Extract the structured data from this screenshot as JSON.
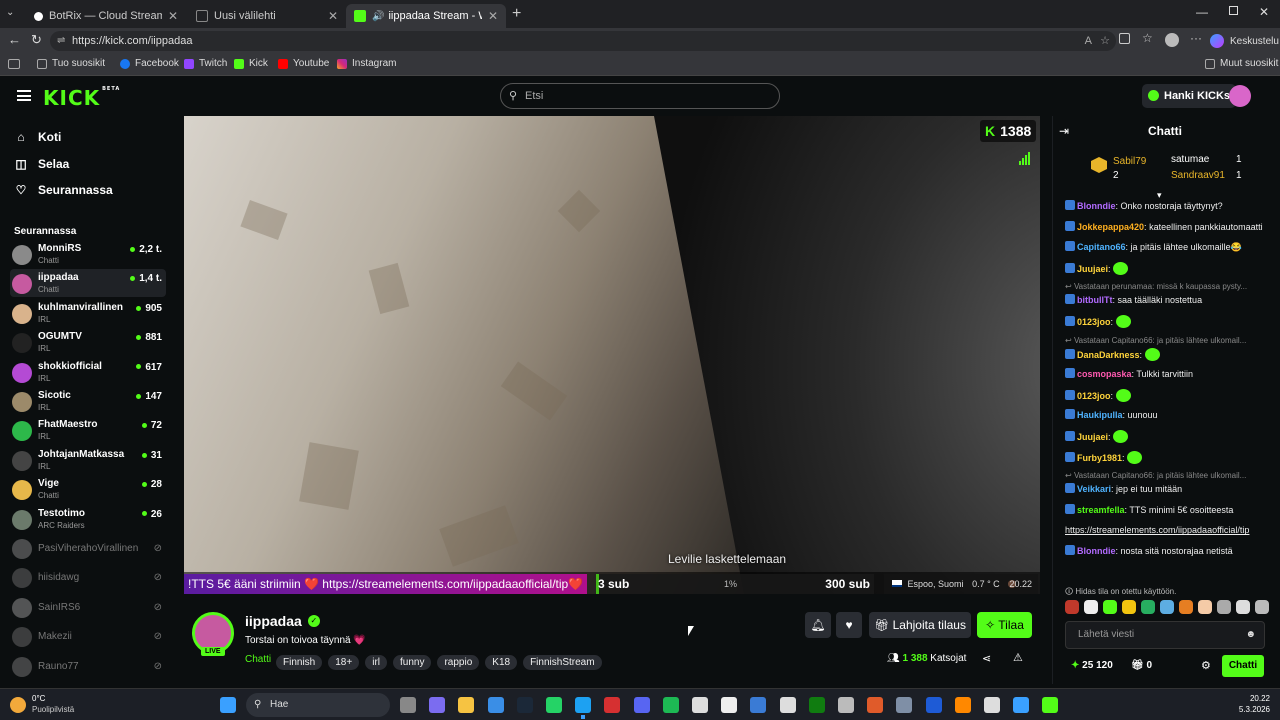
{
  "browser": {
    "tabs": [
      {
        "title": "BotRix — Cloud Streaming Bot for"
      },
      {
        "title": "Uusi välilehti"
      },
      {
        "title": "iippadaa Stream - Watch Live"
      }
    ],
    "url": "https://kick.com/iippadaa",
    "profile_label": "Keskustelu",
    "bookmarks": [
      "Tuo suosikit",
      "Facebook",
      "Twitch",
      "Kick",
      "Youtube",
      "Instagram"
    ],
    "other_bookmarks": "Muut suosikit"
  },
  "header": {
    "logo": "KICK",
    "logo_sup": "BETA",
    "search_placeholder": "Etsi",
    "get_kicks": "Hanki KICKs"
  },
  "nav": [
    {
      "label": "Koti",
      "icon": "home-icon"
    },
    {
      "label": "Selaa",
      "icon": "browse-icon"
    },
    {
      "label": "Seurannassa",
      "icon": "heart-icon"
    }
  ],
  "following_title": "Seurannassa",
  "following": [
    {
      "name": "MonniRS",
      "category": "Chatti",
      "viewers": "2,2 t.",
      "color": "#8a8a8a",
      "live": true
    },
    {
      "name": "iippadaa",
      "category": "Chatti",
      "viewers": "1,4 t.",
      "color": "#c65aa0",
      "live": true
    },
    {
      "name": "kuhlmanvirallinen",
      "category": "IRL",
      "viewers": "905",
      "color": "#d9b38c",
      "live": true
    },
    {
      "name": "OGUMTV",
      "category": "IRL",
      "viewers": "881",
      "color": "#222",
      "live": true
    },
    {
      "name": "shokkiofficial",
      "category": "IRL",
      "viewers": "617",
      "color": "#b44ad4",
      "live": true
    },
    {
      "name": "Sicotic",
      "category": "IRL",
      "viewers": "147",
      "color": "#9c8a6a",
      "live": true
    },
    {
      "name": "FhatMaestro",
      "category": "IRL",
      "viewers": "72",
      "color": "#2db84a",
      "live": true
    },
    {
      "name": "JohtajanMatkassa",
      "category": "IRL",
      "viewers": "31",
      "color": "#444",
      "live": true
    },
    {
      "name": "Vige",
      "category": "Chatti",
      "viewers": "28",
      "color": "#e7b84a",
      "live": true
    },
    {
      "name": "Testotimo",
      "category": "ARC Raiders",
      "viewers": "26",
      "color": "#6b7a6b",
      "live": true
    },
    {
      "name": "PasiViherahoVirallinen",
      "category": "",
      "viewers": "",
      "color": "#999",
      "live": false
    },
    {
      "name": "hiisidawg",
      "category": "",
      "viewers": "",
      "color": "#777",
      "live": false
    },
    {
      "name": "SainIRS6",
      "category": "",
      "viewers": "",
      "color": "#aaa",
      "live": false
    },
    {
      "name": "Makezii",
      "category": "",
      "viewers": "",
      "color": "#777",
      "live": false
    },
    {
      "name": "Rauno77",
      "category": "",
      "viewers": "",
      "color": "#888",
      "live": false
    }
  ],
  "video": {
    "viewer_badge": "1388",
    "caption": "Levilie laskettelemaan",
    "tip_text": "!TTS 5€ ääni striimiin ❤️ https://streamelements.com/iippadaaofficial/tip❤️",
    "sub_goal": {
      "current": "3 sub",
      "percent": "1%",
      "target": "300 sub",
      "progress": 0.01
    },
    "location": "Espoo, Suomi",
    "temperature": "0.7 ° C",
    "time": "20.22"
  },
  "stream": {
    "channel": "iippadaa",
    "live_label": "LIVE",
    "title": "Torstai on toivoa täynnä 💗",
    "tags": [
      "Chatti",
      "Finnish",
      "18+",
      "irl",
      "funny",
      "rappio",
      "K18",
      "FinnishStream"
    ],
    "gift_sub": "Lahjoita tilaus",
    "subscribe": "Tilaa",
    "viewers": "1 388",
    "viewers_label": "Katsojat"
  },
  "chat": {
    "title": "Chatti",
    "leaderboard": [
      {
        "name": "Sabil79",
        "count": "2"
      },
      {
        "name": "satumae",
        "count": "1"
      },
      {
        "name": "Sandraav91",
        "count": "1"
      }
    ],
    "messages": [
      {
        "user": "Blonndie",
        "color": "#b26bff",
        "text": "Onko nostoraja täyttynyt?",
        "reply": ""
      },
      {
        "user": "Jokkepappa420",
        "color": "#ffb020",
        "text": "kateellinen pankkiautomaatti",
        "reply": ""
      },
      {
        "user": "Capitano66",
        "color": "#4fb3ff",
        "text": "ja pitäis lähtee ulkomaille😂",
        "reply": ""
      },
      {
        "user": "Juujaei",
        "color": "#ffd43b",
        "text": "",
        "reply": ""
      },
      {
        "user": "bitbullTt",
        "color": "#b26bff",
        "text": "saa täälläki nostettua",
        "reply": "Vastataan perunamaa: missä k kaupassa pysty..."
      },
      {
        "user": "0123joo",
        "color": "#ffd43b",
        "text": "",
        "reply": ""
      },
      {
        "user": "DanaDarkness",
        "color": "#ffd43b",
        "text": "",
        "reply": "Vastataan Capitano66: ja pitäis lähtee ulkomail..."
      },
      {
        "user": "cosmopaska",
        "color": "#ff5ab0",
        "text": "Tulkki tarvittiin",
        "reply": ""
      },
      {
        "user": "0123joo",
        "color": "#ffd43b",
        "text": "",
        "reply": ""
      },
      {
        "user": "Haukipulla",
        "color": "#4fb3ff",
        "text": "uunouu",
        "reply": ""
      },
      {
        "user": "Juujaei",
        "color": "#ffd43b",
        "text": "",
        "reply": ""
      },
      {
        "user": "Furby1981",
        "color": "#ffd43b",
        "text": "",
        "reply": ""
      },
      {
        "user": "Veikkari",
        "color": "#4fb3ff",
        "text": "jep ei tuu mitään",
        "reply": "Vastataan Capitano66: ja pitäis lähtee ulkomail..."
      },
      {
        "user": "streamfella",
        "color": "#53fc18",
        "text": "TTS minimi 5€ osoitteesta",
        "reply": ""
      },
      {
        "user": "",
        "color": "#ffffff",
        "text": "https://streamelements.com/iippadaaofficial/tip",
        "reply": ""
      },
      {
        "user": "Blonndie",
        "color": "#b26bff",
        "text": "nosta sitä nostorajaa netistä",
        "reply": ""
      }
    ],
    "slow_mode": "Hidas tila on otettu käyttöön.",
    "input_placeholder": "Lähetä viesti",
    "points": "25 120",
    "gifts": "0",
    "send": "Chatti"
  },
  "taskbar": {
    "weather_temp": "0°C",
    "weather_desc": "Puolipilvistä",
    "search": "Hae",
    "time": "20.22",
    "date": "5.3.2026"
  },
  "colors": {
    "kick_green": "#53fc18",
    "bg": "#0b0e0f",
    "panel": "#2a2d33"
  }
}
